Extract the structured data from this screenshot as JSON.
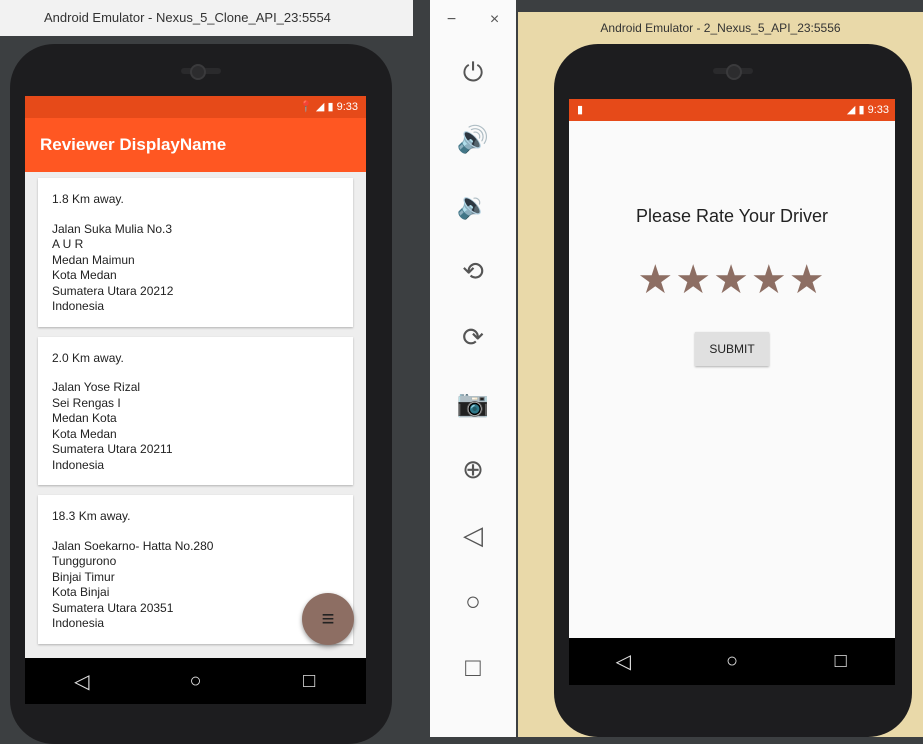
{
  "left_window": {
    "title": "Android Emulator - Nexus_5_Clone_API_23:5554",
    "status_time": "9:33",
    "app_title": "Reviewer DisplayName",
    "cards": [
      {
        "distance": "1.8 Km away.",
        "lines": [
          "Jalan Suka Mulia No.3",
          "A U R",
          "Medan Maimun",
          "Kota Medan",
          "Sumatera Utara 20212",
          "Indonesia"
        ]
      },
      {
        "distance": "2.0 Km away.",
        "lines": [
          "Jalan Yose Rizal",
          "Sei Rengas I",
          "Medan Kota",
          "Kota Medan",
          "Sumatera Utara 20211",
          "Indonesia"
        ]
      },
      {
        "distance": "18.3 Km away.",
        "lines": [
          "Jalan Soekarno- Hatta No.280",
          "Tunggurono",
          "Binjai Timur",
          "Kota Binjai",
          "Sumatera Utara 20351",
          "Indonesia"
        ]
      }
    ],
    "fab_icon": "menu-icon",
    "nav": {
      "back": "◁",
      "home": "○",
      "recents": "□"
    }
  },
  "toolbar": {
    "minimize": "−",
    "close": "×",
    "tools": [
      {
        "name": "power-icon",
        "glyph": "⏻"
      },
      {
        "name": "volume-up-icon",
        "glyph": "🔊"
      },
      {
        "name": "volume-down-icon",
        "glyph": "🔉"
      },
      {
        "name": "rotate-left-icon",
        "glyph": "⟲"
      },
      {
        "name": "rotate-right-icon",
        "glyph": "⟳"
      },
      {
        "name": "camera-icon",
        "glyph": "📷"
      },
      {
        "name": "zoom-icon",
        "glyph": "⊕"
      },
      {
        "name": "back-icon",
        "glyph": "◁"
      },
      {
        "name": "home-icon",
        "glyph": "○"
      },
      {
        "name": "overview-icon",
        "glyph": "□"
      }
    ]
  },
  "right_window": {
    "title": "Android Emulator - 2_Nexus_5_API_23:5556",
    "status_time": "9:33",
    "rate_title": "Please Rate Your Driver",
    "stars": "★★★★★",
    "rating": 5,
    "submit_label": "SUBMIT",
    "nav": {
      "back": "◁",
      "home": "○",
      "recents": "□"
    }
  },
  "colors": {
    "accent": "#ff5722",
    "status": "#e64a19",
    "star": "#8d6e63"
  }
}
